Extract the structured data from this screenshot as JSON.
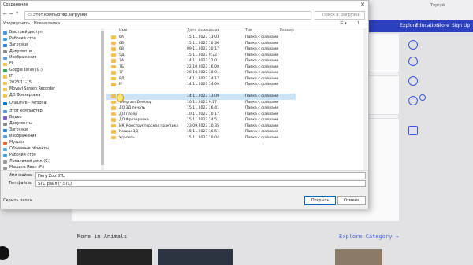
{
  "dialog": {
    "title": "Сохранение",
    "address": [
      "Этот компьютер",
      "Загрузки"
    ],
    "search_placeholder": "Поиск в: Загрузки",
    "toolbar": {
      "organize": "Упорядочить",
      "new_folder": "Новая папка"
    },
    "columns": [
      "Имя",
      "Дата изменения",
      "Тип",
      "Размер"
    ],
    "sidebar": [
      "Быстрый доступ",
      "Рабочий стол",
      "Загрузки",
      "Документы",
      "Изображения",
      "FL",
      "Google Drive (G:)",
      "IF",
      "2023-11-15",
      "Movavi Screen Recorder",
      "ДО Фрезеровка",
      "OneDrive - Personal",
      "Этот компьютер",
      "Видео",
      "Документы",
      "Загрузки",
      "Изображения",
      "Музыка",
      "Объемные объекты",
      "Рабочий стол",
      "Локальный диск (C:)",
      "Машина Иван (F:)"
    ],
    "rows": [
      {
        "name": "6А",
        "date": "15.11.2023 13:03",
        "type": "Папка с файлами"
      },
      {
        "name": "6Б",
        "date": "15.11.2023 10:36",
        "type": "Папка с файлами"
      },
      {
        "name": "6В",
        "date": "09.11.2023 10:17",
        "type": "Папка с файлами"
      },
      {
        "name": "5Д",
        "date": "15.11.2023 9:22",
        "type": "Папка с файлами"
      },
      {
        "name": "7А",
        "date": "14.11.2023 12:01",
        "type": "Папка с файлами"
      },
      {
        "name": "7Б",
        "date": "22.10.2023 16:08",
        "type": "Папка с файлами"
      },
      {
        "name": "7Г",
        "date": "26.10.2023 18:01",
        "type": "Папка с файлами"
      },
      {
        "name": "8Д",
        "date": "14.11.2023 14:17",
        "type": "Папка с файлами"
      },
      {
        "name": "IF",
        "date": "14.11.2023 14:09",
        "type": "Папка с файлами"
      },
      {
        "name": "",
        "date": "14.11.2023 13:09",
        "type": "Папка с файлами"
      },
      {
        "name": "Telegram Desktop",
        "date": "10.11.2023 9:27",
        "type": "Папка с файлами"
      },
      {
        "name": "ДО 3Д печать",
        "date": "15.11.2023 16:41",
        "type": "Папка с файлами"
      },
      {
        "name": "ДО Лазер",
        "date": "10.11.2023 10:17",
        "type": "Папка с файлами"
      },
      {
        "name": "ДО Фрезеровка",
        "date": "15.11.2023 14:51",
        "type": "Папка с файлами"
      },
      {
        "name": "ИК_Конструкторская практика",
        "date": "23.09.2023 10:35",
        "type": "Папка с файлами"
      },
      {
        "name": "Кошки 3Д",
        "date": "15.11.2023 16:51",
        "type": "Папка с файлами"
      },
      {
        "name": "Удалить",
        "date": "15.11.2023 10:04",
        "type": "Папка с файлами"
      }
    ],
    "file_name_label": "Имя файла:",
    "file_name_value": "Fiery Zoo STL",
    "file_type_label": "Тип файла:",
    "file_type_value": "STL файл (*.STL)",
    "hide_folders": "Скрыть папки",
    "save_label": "Открыть",
    "cancel_label": "Отмена"
  },
  "site": {
    "nav": [
      "Explore",
      "Education",
      "Store",
      "Sign Up"
    ],
    "more_title": "More in Animals",
    "explore_link": "Explore Category →",
    "topic": "Торгуй"
  }
}
